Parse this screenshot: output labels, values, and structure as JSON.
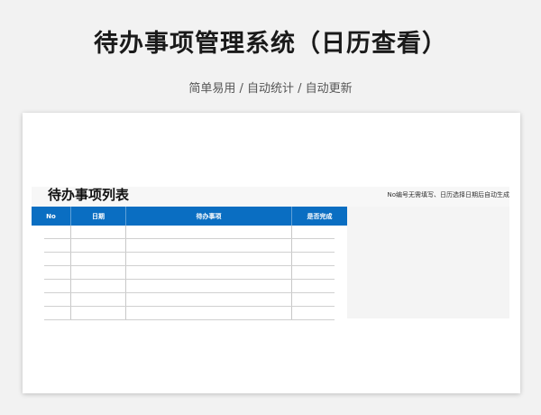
{
  "page": {
    "title": "待办事项管理系统（日历查看）",
    "subtitle": "简单易用 / 自动统计 / 自动更新"
  },
  "sheet": {
    "title": "待办事项列表",
    "hint": "No编号无需填写、日历选择日期后自动生成",
    "columns": [
      "No",
      "日期",
      "待办事项",
      "是否完成"
    ],
    "rows": [
      {
        "no": "",
        "date": "",
        "task": "",
        "done": ""
      },
      {
        "no": "",
        "date": "",
        "task": "",
        "done": ""
      },
      {
        "no": "",
        "date": "",
        "task": "",
        "done": ""
      },
      {
        "no": "",
        "date": "",
        "task": "",
        "done": ""
      },
      {
        "no": "",
        "date": "",
        "task": "",
        "done": ""
      },
      {
        "no": "",
        "date": "",
        "task": "",
        "done": ""
      },
      {
        "no": "",
        "date": "",
        "task": "",
        "done": ""
      }
    ]
  },
  "colors": {
    "header_blue": "#0a6ec2",
    "panel_gray": "#f4f4f4"
  }
}
